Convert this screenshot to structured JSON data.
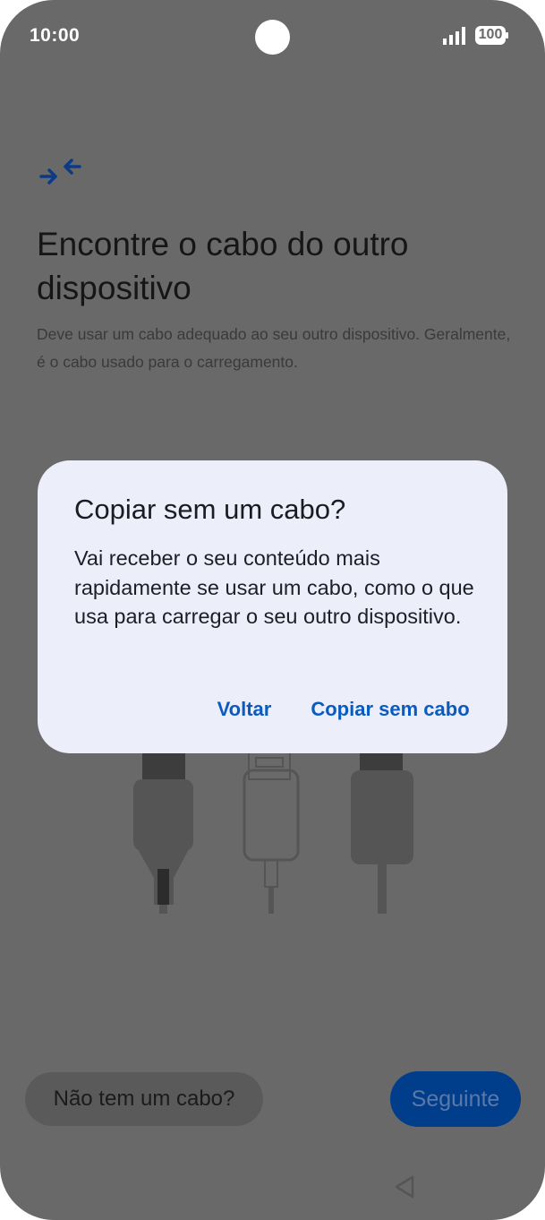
{
  "status_bar": {
    "time": "10:00",
    "battery": "100"
  },
  "main": {
    "title": "Encontre o cabo do outro dispositivo",
    "description": "Deve usar um cabo adequado ao seu outro dispositivo. Geralmente, é o cabo usado para o carregamento.",
    "icon": "transfer-arrows-icon"
  },
  "dialog": {
    "title": "Copiar sem um cabo?",
    "body": "Vai receber o seu conteúdo mais rapidamente se usar um cabo, como o que usa para carregar o seu outro dispositivo.",
    "back_label": "Voltar",
    "copy_label": "Copiar sem cabo"
  },
  "footer": {
    "no_cable_label": "Não tem um cabo?",
    "next_label": "Seguinte"
  },
  "colors": {
    "scrim_background": "#696969",
    "dialog_background": "#eceef9",
    "accent": "#0a5bc0",
    "primary_button": "#003d8a"
  }
}
